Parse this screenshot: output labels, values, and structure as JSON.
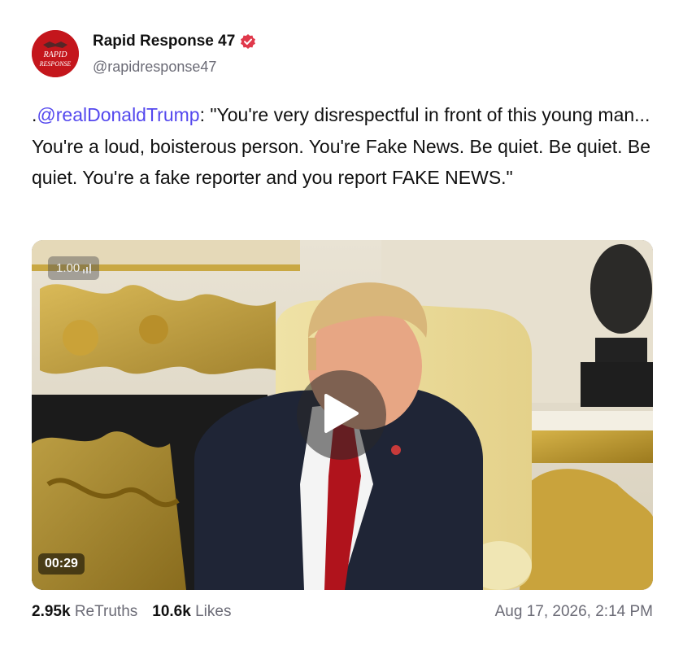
{
  "author": {
    "display_name": "Rapid Response 47",
    "handle": "@rapidresponse47",
    "avatar_text_top": "RAPID",
    "avatar_text_bottom": "RESPONSE",
    "verified": true,
    "avatar_color": "#c4161c",
    "verified_color": "#e0394b"
  },
  "post": {
    "prefix": ".",
    "mention": "@realDonaldTrump",
    "body": ": \"You're very disrespectful in front of this young man... You're a loud, boisterous person. You're Fake News. Be quiet. Be quiet. Be quiet. You're a fake reporter and you report FAKE NEWS.\"",
    "mention_color": "#5448ee"
  },
  "video": {
    "speed_label": "1.00",
    "duration": "00:29",
    "play_icon": "play-icon"
  },
  "stats": {
    "retruths_count": "2.95k",
    "retruths_label": "ReTruths",
    "likes_count": "10.6k",
    "likes_label": "Likes"
  },
  "timestamp": "Aug 17, 2026, 2:14 PM"
}
